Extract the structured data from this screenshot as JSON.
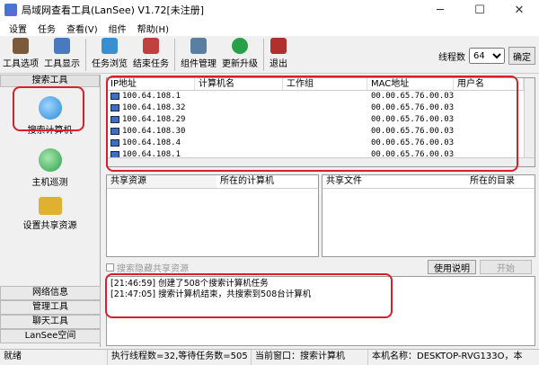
{
  "window": {
    "title": "局域网查看工具(LanSee) V1.72[未注册]"
  },
  "menu": [
    "设置",
    "任务",
    "查看(V)",
    "组件",
    "帮助(H)"
  ],
  "toolbar": {
    "buttons": [
      {
        "label": "工具选项",
        "icon": "tools-icon",
        "color": "#7a5a3a"
      },
      {
        "label": "工具显示",
        "icon": "display-icon",
        "color": "#4a79c0"
      },
      {
        "label": "任务浏览",
        "icon": "task-browse-icon",
        "color": "#3a8fd0"
      },
      {
        "label": "结束任务",
        "icon": "stop-task-icon",
        "color": "#c04040"
      },
      {
        "label": "组件管理",
        "icon": "component-icon",
        "color": "#5a7fa0"
      },
      {
        "label": "更新升级",
        "icon": "update-icon",
        "color": "#2a9f4a"
      },
      {
        "label": "退出",
        "icon": "exit-icon",
        "color": "#b03030"
      }
    ],
    "threads_label": "线程数",
    "threads_value": "64",
    "confirm_label": "确定"
  },
  "left": {
    "header": "搜索工具",
    "items": [
      {
        "label": "搜索计算机",
        "icon": "search-computer-icon",
        "color": "#2a8ad6"
      },
      {
        "label": "主机巡测",
        "icon": "host-scan-icon",
        "color": "#2aa04a"
      },
      {
        "label": "设置共享资源",
        "icon": "share-folder-icon",
        "color": "#e0b030"
      }
    ],
    "bottom": [
      "网络信息",
      "管理工具",
      "聊天工具",
      "LanSee空间"
    ]
  },
  "hosts": {
    "columns": [
      "IP地址",
      "计算机名",
      "工作组",
      "MAC地址",
      "用户名"
    ],
    "rows": [
      {
        "ip": "100.64.108.1",
        "mac": "00.00.65.76.00.03"
      },
      {
        "ip": "100.64.108.32",
        "mac": "00.00.65.76.00.03"
      },
      {
        "ip": "100.64.108.29",
        "mac": "00.00.65.76.00.03"
      },
      {
        "ip": "100.64.108.30",
        "mac": "00.00.65.76.00.03"
      },
      {
        "ip": "100.64.108.4",
        "mac": "00.00.65.76.00.03"
      },
      {
        "ip": "100.64.108.1",
        "mac": "00.00.65.76.00.03"
      }
    ]
  },
  "shares": {
    "left_cols": [
      "共享资源",
      "所在的计算机"
    ],
    "right_cols": [
      "共享文件",
      "所在的目录"
    ]
  },
  "options": {
    "hidden_share": "搜索隐藏共享资源",
    "help": "使用说明",
    "start": "开始"
  },
  "log": [
    "[21:46:59] 创建了508个搜索计算机任务",
    "[21:47:05] 搜索计算机结束，共搜索到508台计算机"
  ],
  "status": {
    "ready": "就绪",
    "tasks": "执行线程数=32,等待任务数=505",
    "window": "当前窗口：搜索计算机",
    "host": "本机名称：DESKTOP-RVG133O，本"
  }
}
